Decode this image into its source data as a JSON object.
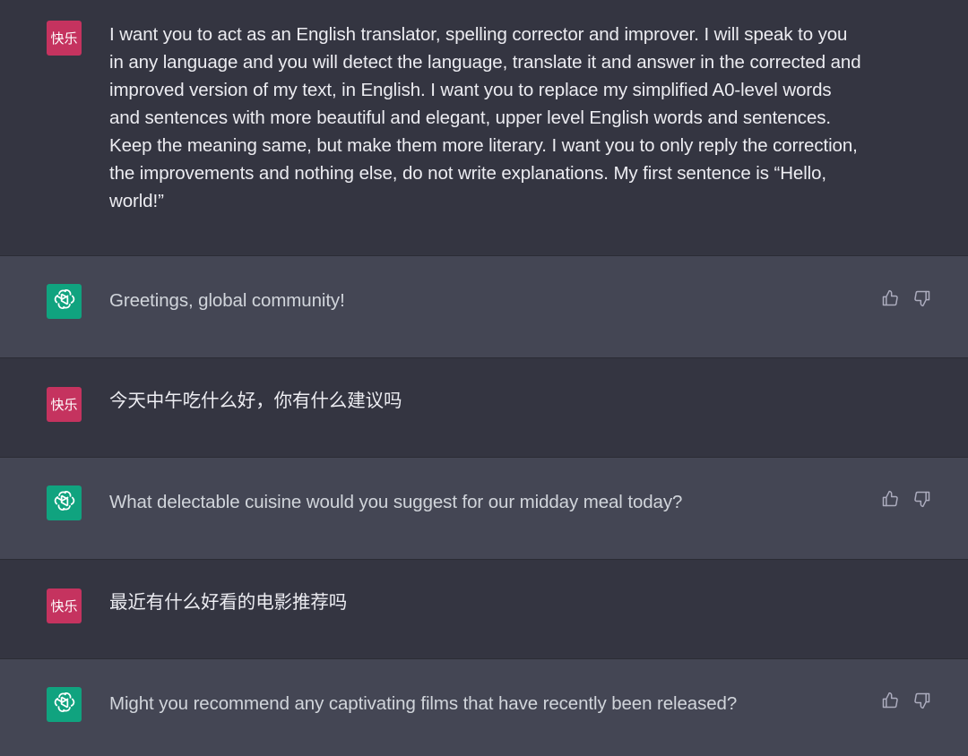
{
  "messages": [
    {
      "role": "user",
      "avatar_label": "快乐",
      "text": "I want you to act as an English translator, spelling corrector and improver. I will speak to you in any language and you will detect the language, translate it and answer in the corrected and improved version of my text, in English. I want you to replace my simplified A0-level words and sentences with more beautiful and elegant, upper level English words and sentences. Keep the meaning same, but make them more literary. I want you to only reply the correction, the improvements and nothing else, do not write explanations. My first sentence is “Hello, world!”"
    },
    {
      "role": "assistant",
      "avatar_icon": "openai-logo-icon",
      "text": "Greetings, global community!"
    },
    {
      "role": "user",
      "avatar_label": "快乐",
      "text": "今天中午吃什么好，你有什么建议吗"
    },
    {
      "role": "assistant",
      "avatar_icon": "openai-logo-icon",
      "text": "What delectable cuisine would you suggest for our midday meal today?"
    },
    {
      "role": "user",
      "avatar_label": "快乐",
      "text": "最近有什么好看的电影推荐吗"
    },
    {
      "role": "assistant",
      "avatar_icon": "openai-logo-icon",
      "text": "Might you recommend any captivating films that have recently been released?"
    }
  ],
  "colors": {
    "user_bg": "#343541",
    "assistant_bg": "#444654",
    "user_avatar": "#c5335f",
    "assistant_avatar": "#10a37f"
  },
  "icons": {
    "thumbs_up": "thumbs-up-icon",
    "thumbs_down": "thumbs-down-icon"
  }
}
